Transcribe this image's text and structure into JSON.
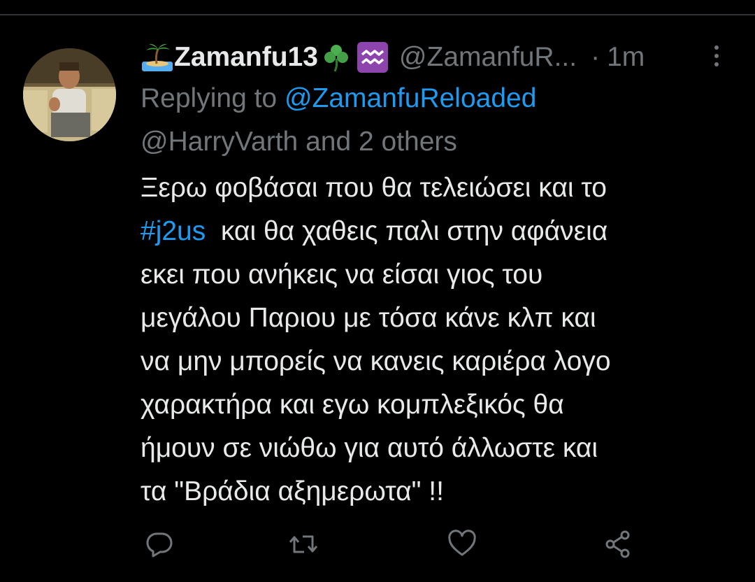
{
  "tweet": {
    "display_name": "Zamanfu13",
    "handle": "@ZamanfuR...",
    "separator": "·",
    "timestamp": "1m",
    "reply": {
      "prefix": "Replying to ",
      "mention_primary": "@ZamanfuReloaded",
      "mention_others": "@HarryVarth and 2 others"
    },
    "text": {
      "line1": "Ξερω φοβάσαι που θα τελειώσει και το",
      "hashtag": "#j2us",
      "line2_rest": "  και θα χαθεις παλι στην αφάνεια",
      "line3": "εκει που ανήκεις να είσαι γιος του",
      "line4": "μεγάλου Παριου με τόσα κάνε κλπ και",
      "line5": "να μην μπορείς να κανεις καριέρα λογο",
      "line6": "χαρακτήρα και εγω κομπλεξικός θα",
      "line7": "ήμουν σε νιώθω για αυτό άλλωστε και",
      "line8": "τα \"Βράδια αξημερωτα\" !!"
    },
    "name_emojis": [
      "desert-island-emoji",
      "shamrock-emoji",
      "aquarius-emoji"
    ],
    "actions": [
      "reply-icon",
      "retweet-icon",
      "like-icon",
      "share-icon"
    ]
  },
  "colors": {
    "background": "#000000",
    "text": "#e7e9ea",
    "muted": "#71767b",
    "link": "#1d9bf0",
    "divider": "#2f3336"
  }
}
